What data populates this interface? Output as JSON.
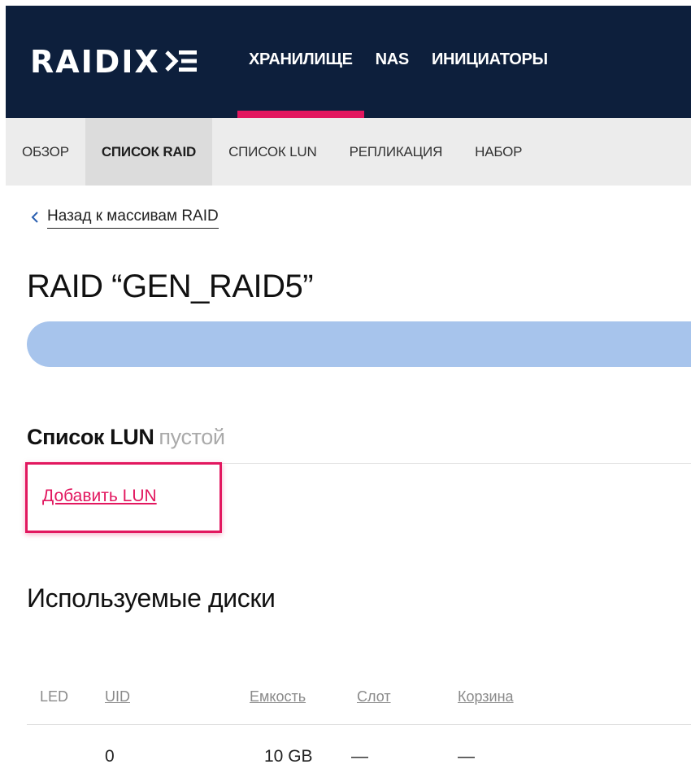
{
  "brand": {
    "logo_text": "RAIDIX",
    "accent_color": "#e2175f",
    "header_color": "#0d1f3c"
  },
  "top_nav": {
    "items": [
      {
        "label": "ХРАНИЛИЩЕ",
        "active": true
      },
      {
        "label": "NAS",
        "active": false
      },
      {
        "label": "ИНИЦИАТОРЫ",
        "active": false
      }
    ]
  },
  "sub_nav": {
    "items": [
      {
        "label": "ОБЗОР",
        "active": false
      },
      {
        "label": "СПИСОК RAID",
        "active": true
      },
      {
        "label": "СПИСОК LUN",
        "active": false
      },
      {
        "label": "РЕПЛИКАЦИЯ",
        "active": false
      },
      {
        "label": "НАБОР",
        "active": false
      }
    ]
  },
  "back_link": {
    "icon": "chevron-left-icon",
    "label": "Назад к массивам RAID"
  },
  "page_title": "RAID “GEN_RAID5”",
  "raid_bar": {
    "fill_fraction": 1.0,
    "fill_color": "#a7c4ec"
  },
  "lun_section": {
    "title": "Список LUN",
    "status": "пустой",
    "add_label": "Добавить LUN"
  },
  "disks_section": {
    "title": "Используемые диски",
    "columns": [
      "LED",
      "UID",
      "Емкость",
      "Слот",
      "Корзина"
    ],
    "rows": [
      {
        "led": "",
        "uid": "0",
        "capacity": "10 GB",
        "slot": "—",
        "basket": "—"
      }
    ]
  }
}
